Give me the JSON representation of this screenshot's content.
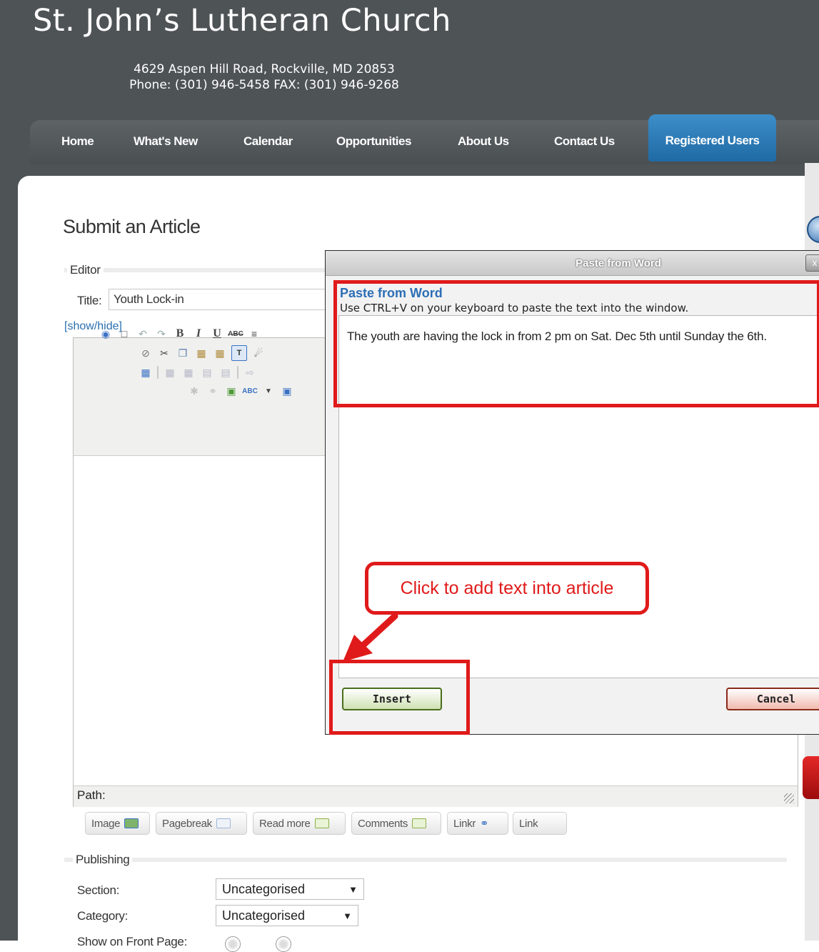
{
  "site": {
    "title": "St. John’s Lutheran Church",
    "address": "4629 Aspen Hill Road, Rockville, MD 20853",
    "phone": "Phone: (301) 946-5458 FAX: (301) 946-9268"
  },
  "nav": {
    "items": [
      "Home",
      "What's New",
      "Calendar",
      "Opportunities",
      "About Us",
      "Contact Us"
    ],
    "active": "Registered Users"
  },
  "page": {
    "heading": "Submit an Article"
  },
  "editor": {
    "legend": "Editor",
    "title_label": "Title:",
    "title_value": "Youth Lock-in",
    "show_hide": "[show/hide]",
    "path_label": "Path:",
    "toolbar_icons": {
      "row1": [
        "help-icon",
        "new-document-icon",
        "undo-icon",
        "redo-icon",
        "bold-icon",
        "italic-icon",
        "underline-icon",
        "strikethrough-icon",
        "align-left-icon"
      ],
      "row2": [
        "eraser-icon",
        "cut-icon",
        "copy-icon",
        "paste-icon",
        "paste-word-icon",
        "paste-text-icon",
        "find-icon"
      ],
      "row3": [
        "edit-table-icon",
        "delete-row-icon",
        "insert-row-icon",
        "merge-cells-icon",
        "split-cells-icon",
        "indent-icon"
      ],
      "row4": [
        "unlink-icon",
        "link-icon",
        "image-icon",
        "spellcheck-icon",
        "dropdown-icon",
        "fullscreen-icon"
      ]
    },
    "buttons": [
      "Image",
      "Pagebreak",
      "Read more",
      "Comments",
      "Linkr",
      "Link"
    ]
  },
  "publishing": {
    "legend": "Publishing",
    "section_label": "Section:",
    "section_value": "Uncategorised",
    "category_label": "Category:",
    "category_value": "Uncategorised",
    "frontpage_label": "Show on Front Page:"
  },
  "dialog": {
    "title": "Paste from Word",
    "heading": "Paste from Word",
    "instructions": "Use CTRL+V on your keyboard to paste the text into the window.",
    "pasted_text": "The youth are having the lock in from 2 pm on Sat. Dec 5th until Sunday the 6th.",
    "insert_label": "Insert",
    "cancel_label": "Cancel",
    "close_glyph": "x"
  },
  "annotation": {
    "callout_text": "Click to add text into article",
    "color": "#e01a1a"
  },
  "colors": {
    "site_background": "#4e5356",
    "nav_active": "#1f6aa5",
    "link": "#2a6fb0",
    "dialog_heading": "#2c6fb5"
  }
}
